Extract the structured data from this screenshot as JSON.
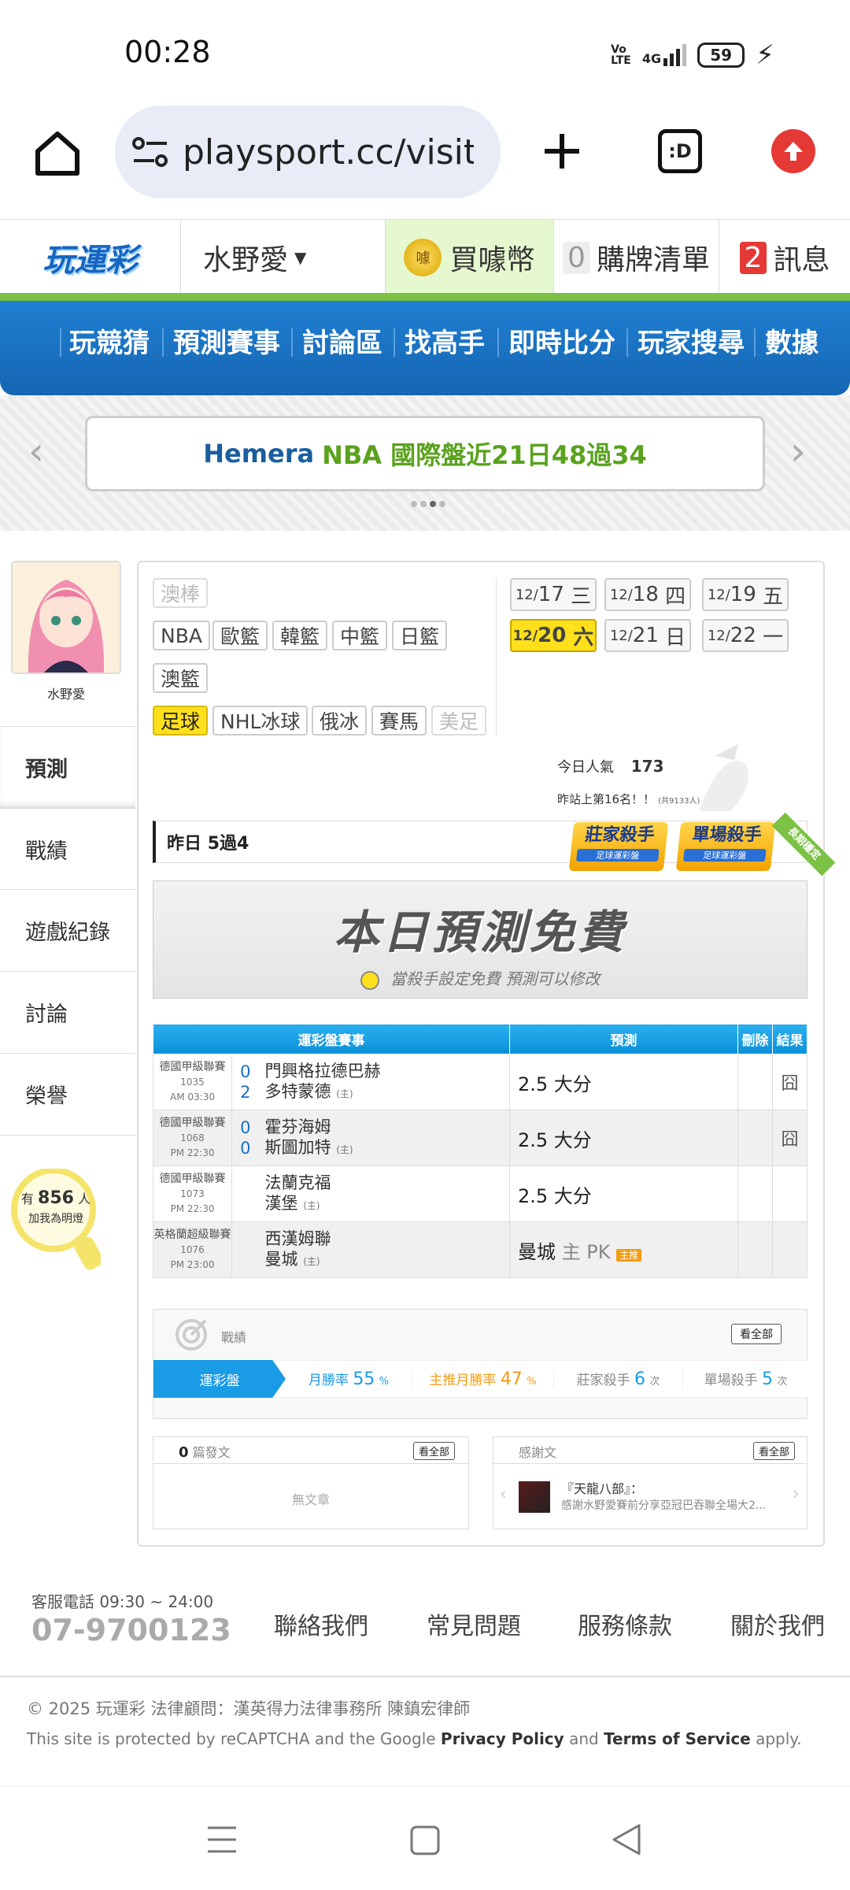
{
  "status": {
    "time": "00:28",
    "network": "4G",
    "battery": "59"
  },
  "browser": {
    "url": "playsport.cc/visit"
  },
  "site_header": {
    "username": "水野愛",
    "coin_label": "買噱幣",
    "coin_badge": "噱",
    "cart_count": "0",
    "cart_label": "購牌清單",
    "msg_count": "2",
    "msg_label": "訊息"
  },
  "nav": [
    "玩競猜",
    "預測賽事",
    "討論區",
    "找高手",
    "即時比分",
    "玩家搜尋",
    "數據"
  ],
  "banner": {
    "part1": "Hemera",
    "part2": "NBA 國際盤近21日48過34"
  },
  "profile": {
    "name": "水野愛"
  },
  "sidebar": {
    "items": [
      "預測",
      "戰績",
      "遊戲紀錄",
      "討論",
      "榮譽"
    ],
    "fans_prefix": "有",
    "fans_count": "856",
    "fans_suffix": "人",
    "fans_sub": "加我為明燈"
  },
  "sports": {
    "row1": [
      "澳棒"
    ],
    "row2": [
      "NBA",
      "歐籃",
      "韓籃",
      "中籃",
      "日籃"
    ],
    "row3": [
      "澳籃"
    ],
    "row4": [
      "足球",
      "NHL冰球",
      "俄冰",
      "賽馬",
      "美足"
    ]
  },
  "dates": [
    {
      "m": "12/",
      "d": "17",
      "w": "三"
    },
    {
      "m": "12/",
      "d": "18",
      "w": "四"
    },
    {
      "m": "12/",
      "d": "19",
      "w": "五"
    },
    {
      "m": "12/",
      "d": "20",
      "w": "六"
    },
    {
      "m": "12/",
      "d": "21",
      "w": "日"
    },
    {
      "m": "12/",
      "d": "22",
      "w": "一"
    }
  ],
  "popularity": {
    "label": "今日人氣",
    "value": "173",
    "rank": "昨站上第16名！！",
    "rank_sub": "(共9133人)"
  },
  "yesterday": {
    "label": "昨日",
    "value": "5過4"
  },
  "badges": {
    "b1": "莊家殺手",
    "b1_sub": "足球運彩盤",
    "b2": "單場殺手",
    "b2_sub": "足球運彩盤",
    "ribbon": "長期穩定"
  },
  "free_banner": {
    "title": "本日預測免費",
    "sub": "當殺手設定免費 預測可以修改"
  },
  "table": {
    "headers": [
      "運彩盤賽事",
      "預測",
      "刪除",
      "結果"
    ],
    "rows": [
      {
        "league": "德國甲級聯賽",
        "no": "1035",
        "time": "AM 03:30",
        "s1": "0",
        "s2": "2",
        "t1": "門興格拉德巴赫",
        "t2": "多特蒙德",
        "home": "(主)",
        "pred": "2.5 大分",
        "result": "囧"
      },
      {
        "league": "德國甲級聯賽",
        "no": "1068",
        "time": "PM 22:30",
        "s1": "0",
        "s2": "0",
        "t1": "霍芬海姆",
        "t2": "斯圖加特",
        "home": "(主)",
        "pred": "2.5 大分",
        "result": "囧"
      },
      {
        "league": "德國甲級聯賽",
        "no": "1073",
        "time": "PM 22:30",
        "s1": "",
        "s2": "",
        "t1": "法蘭克福",
        "t2": "漢堡",
        "home": "(主)",
        "pred": "2.5 大分",
        "result": ""
      },
      {
        "league": "英格蘭超級聯賽",
        "no": "1076",
        "time": "PM 23:00",
        "s1": "",
        "s2": "",
        "t1": "西漢姆聯",
        "t2": "曼城",
        "home": "(主)",
        "pred": "曼城",
        "pred_extra": "主 PK",
        "pred_badge": "主推",
        "result": ""
      }
    ]
  },
  "record": {
    "title": "戰績",
    "see_all": "看全部",
    "tab": "運彩盤",
    "month_label": "月勝率",
    "month_value": "55",
    "pct": "%",
    "main_label": "主推月勝率",
    "main_value": "47",
    "banker_label": "莊家殺手",
    "banker_value": "6",
    "single_label": "單場殺手",
    "single_value": "5",
    "times": "次"
  },
  "posts": {
    "count": "0",
    "label": "篇發文",
    "see_all": "看全部",
    "empty": "無文章"
  },
  "thanks": {
    "label": "感謝文",
    "see_all": "看全部",
    "title": "『天龍八部』：",
    "text": "感謝水野愛賽前分享亞冠巴吞聯全場大2..."
  },
  "footer": {
    "phone_label": "客服電話 09:30 ~ 24:00",
    "phone": "07-9700123",
    "links": [
      "聯絡我們",
      "常見問題",
      "服務條款",
      "關於我們"
    ],
    "copyright": "© 2025 玩運彩 法律顧問：漢英得力法律事務所 陳鎮宏律師",
    "recaptcha_pre": "This site is protected by reCAPTCHA and the Google",
    "privacy": "Privacy Policy",
    "and": "and",
    "terms": "Terms of Service",
    "apply": "apply."
  }
}
